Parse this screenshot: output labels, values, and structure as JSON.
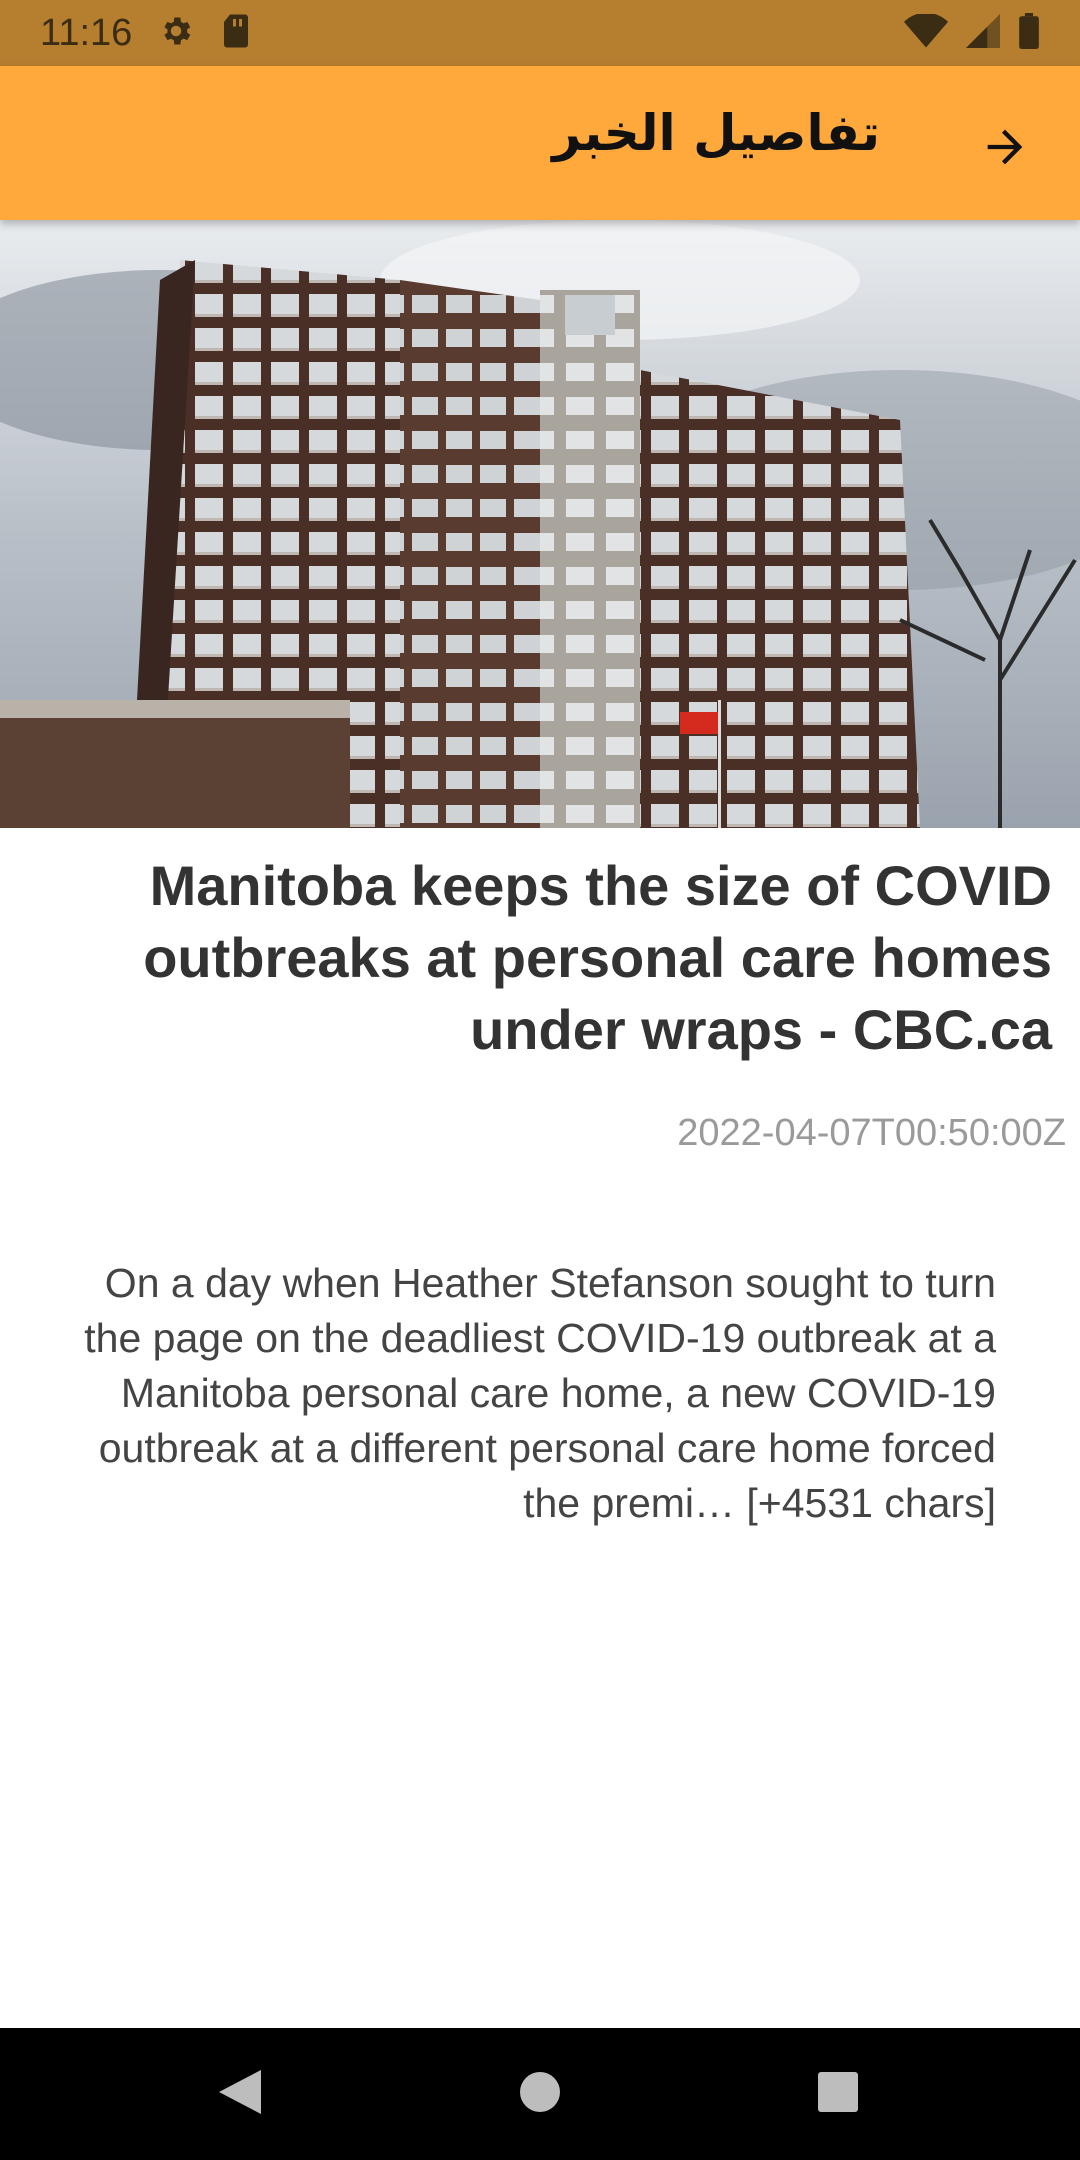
{
  "status_bar": {
    "time": "11:16",
    "icons": [
      "settings-icon",
      "sd-card-icon",
      "wifi-icon",
      "cell-signal-icon",
      "battery-icon"
    ],
    "background": "#B67E2F"
  },
  "app_bar": {
    "title": "تفاصيل الخبر",
    "back_icon": "arrow-forward-icon",
    "background": "#FFA93C"
  },
  "article": {
    "image_description": "photo",
    "headline": "Manitoba keeps the size of COVID outbreaks at personal care homes under wraps - CBC.ca",
    "published_at": "2022-04-07T00:50:00Z",
    "content": "On a day when Heather Stefanson sought to turn the page on the deadliest COVID-19 outbreak at a Manitoba personal care home, a new COVID-19 outbreak at a different personal care home forced the premi… [+4531 chars]"
  },
  "nav_bar": {
    "buttons": [
      "back-triangle-icon",
      "home-circle-icon",
      "recents-square-icon"
    ]
  }
}
